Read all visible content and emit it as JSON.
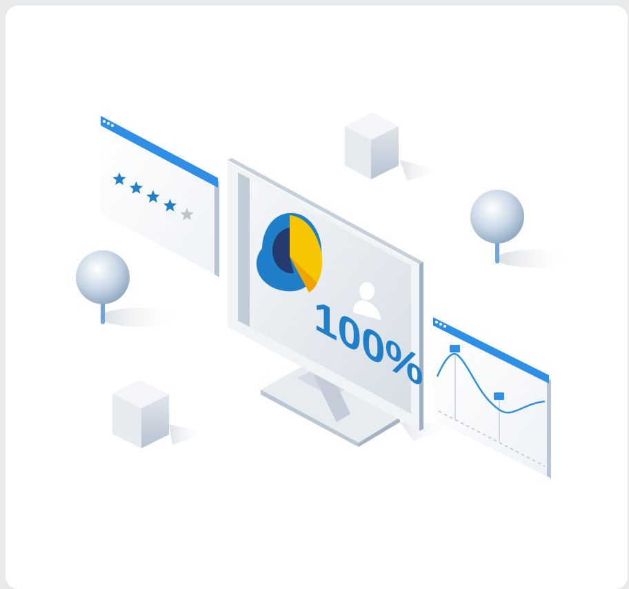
{
  "illustration": {
    "percent_label": "100%",
    "rating": {
      "filled": 4,
      "total": 5
    },
    "colors": {
      "accent_blue": "#2f8ee5",
      "percent_blue": "#1f7fc8",
      "pie_yellow": "#f7c600",
      "pie_orange": "#f0a400",
      "pie_navy": "#253b6e",
      "star_blue": "#1f7fc8",
      "star_gray": "#bfc5cc"
    },
    "icons": [
      "star-icon",
      "user-icon",
      "pie-chart-icon",
      "line-chart-icon",
      "monitor-icon",
      "cube-icon",
      "sphere-pin-icon"
    ]
  }
}
